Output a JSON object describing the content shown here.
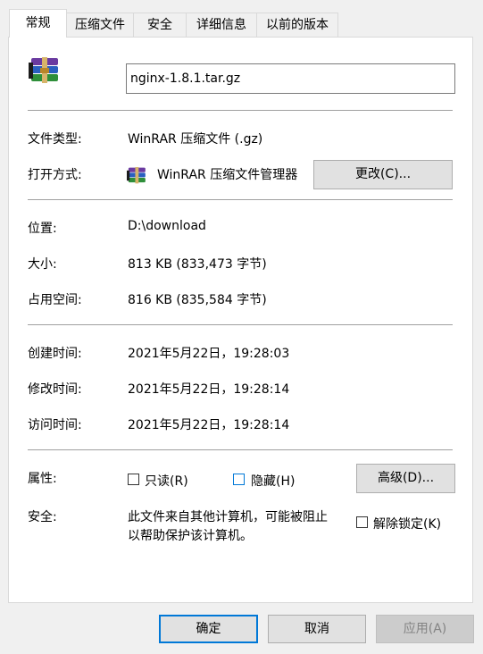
{
  "tabs": [
    {
      "label": "常规",
      "active": true
    },
    {
      "label": "压缩文件"
    },
    {
      "label": "安全"
    },
    {
      "label": "详细信息"
    },
    {
      "label": "以前的版本"
    }
  ],
  "file": {
    "name": "nginx-1.8.1.tar.gz",
    "icon": "winrar-archive-icon"
  },
  "rows": {
    "type_label": "文件类型:",
    "type_value": "WinRAR 压缩文件 (.gz)",
    "open_label": "打开方式:",
    "open_value": "WinRAR 压缩文件管理器",
    "change_button": "更改(C)...",
    "location_label": "位置:",
    "location_value": "D:\\download",
    "size_label": "大小:",
    "size_value": "813 KB (833,473 字节)",
    "disk_label": "占用空间:",
    "disk_value": "816 KB (835,584 字节)",
    "created_label": "创建时间:",
    "created_value": "2021年5月22日，19:28:03",
    "modified_label": "修改时间:",
    "modified_value": "2021年5月22日，19:28:14",
    "accessed_label": "访问时间:",
    "accessed_value": "2021年5月22日，19:28:14"
  },
  "attributes": {
    "label": "属性:",
    "readonly": "只读(R)",
    "hidden": "隐藏(H)",
    "advanced": "高级(D)..."
  },
  "security": {
    "label": "安全:",
    "message_line1": "此文件来自其他计算机，可能被阻止",
    "message_line2": "以帮助保护该计算机。",
    "unblock": "解除锁定(K)"
  },
  "footer": {
    "ok": "确定",
    "cancel": "取消",
    "apply": "应用(A)"
  },
  "colors": {
    "accent": "#0078d7",
    "panel": "#ffffff",
    "background": "#f0f0f0"
  }
}
